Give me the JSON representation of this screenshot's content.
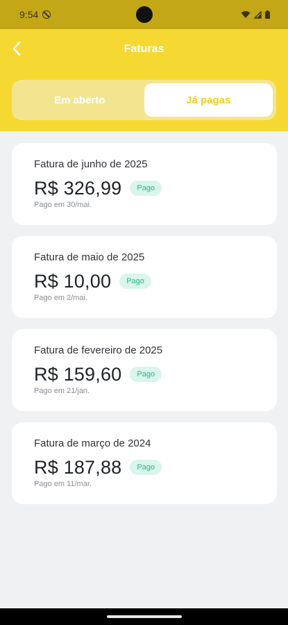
{
  "status_bar": {
    "time": "9:54"
  },
  "header": {
    "title": "Faturas",
    "tabs": [
      {
        "label": "Em aberto",
        "active": false
      },
      {
        "label": "Já pagas",
        "active": true
      }
    ]
  },
  "invoices": [
    {
      "title": "Fatura de junho de 2025",
      "amount": "R$ 326,99",
      "status": "Pago",
      "paid_on": "Pago em 30/mai."
    },
    {
      "title": "Fatura de maio de 2025",
      "amount": "R$ 10,00",
      "status": "Pago",
      "paid_on": "Pago em 2/mai."
    },
    {
      "title": "Fatura de fevereiro de 2025",
      "amount": "R$ 159,60",
      "status": "Pago",
      "paid_on": "Pago em 21/jan."
    },
    {
      "title": "Fatura de março de 2024",
      "amount": "R$ 187,88",
      "status": "Pago",
      "paid_on": "Pago em 11/mar."
    }
  ],
  "colors": {
    "brand_yellow": "#f5d932",
    "status_bar": "#c4a717",
    "paid_badge_bg": "#d9f5ec",
    "paid_badge_text": "#28b689"
  },
  "icons": [
    "do-not-disturb-icon",
    "wifi-icon",
    "signal-icon",
    "battery-icon",
    "back-arrow-icon"
  ]
}
